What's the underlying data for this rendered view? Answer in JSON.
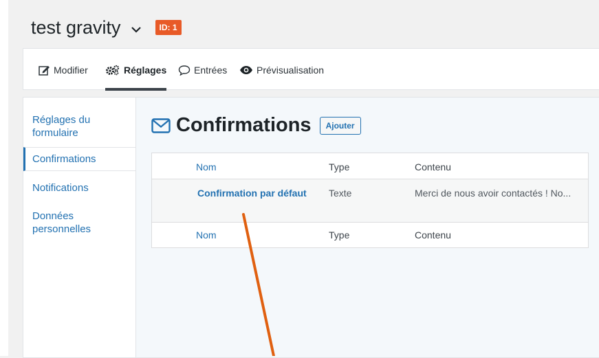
{
  "form": {
    "title": "test gravity",
    "id_badge": "ID: 1"
  },
  "toolbar": [
    {
      "label": "Modifier",
      "icon": "edit-icon"
    },
    {
      "label": "Réglages",
      "icon": "gears-icon",
      "active": true
    },
    {
      "label": "Entrées",
      "icon": "comment-icon"
    },
    {
      "label": "Prévisualisation",
      "icon": "eye-icon"
    }
  ],
  "sidebar": {
    "items": [
      {
        "line1": "Réglages du",
        "line2": "formulaire"
      },
      {
        "line1": "Confirmations",
        "active": true
      },
      {
        "line1": "Notifications"
      },
      {
        "line1": "Données",
        "line2": "personnelles"
      }
    ]
  },
  "main": {
    "heading": "Confirmations",
    "add_button": "Ajouter",
    "table": {
      "columns": [
        "Nom",
        "Type",
        "Contenu"
      ],
      "rows": [
        {
          "name": "Confirmation par défaut",
          "type": "Texte",
          "content": "Merci de nous avoir contactés ! No..."
        }
      ]
    }
  },
  "colors": {
    "accent": "#2271b1",
    "badge": "#e85a27",
    "annotation": "#e06010"
  }
}
